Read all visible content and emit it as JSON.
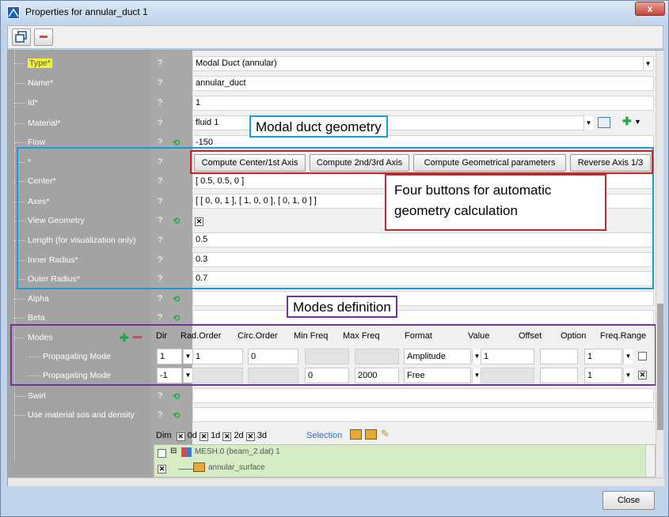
{
  "window": {
    "title": "Properties for annular_duct 1",
    "close_glyph": "x"
  },
  "rows": [
    {
      "label": "Type*",
      "q": "?",
      "value": "Modal Duct (annular)"
    },
    {
      "label": "Name*",
      "q": "?",
      "value": "annular_duct"
    },
    {
      "label": "Id*",
      "q": "?",
      "value": "1"
    },
    {
      "label": "Material*",
      "q": "?",
      "value": "fluid 1"
    },
    {
      "label": "Flow",
      "q": "?",
      "value": "-150"
    },
    {
      "label": "*",
      "q": "?",
      "value": ""
    },
    {
      "label": "Center*",
      "q": "?",
      "value": "[ 0.5, 0.5, 0 ]"
    },
    {
      "label": "Axes*",
      "q": "?",
      "value": "[ [ 0, 0, 1 ], [ 1, 0, 0 ], [ 0, 1, 0 ] ]"
    },
    {
      "label": "View Geometry",
      "q": "?",
      "value": ""
    },
    {
      "label": "Length (for visualization only)",
      "q": "?",
      "value": "0.5"
    },
    {
      "label": "Inner Radius*",
      "q": "?",
      "value": "0.3"
    },
    {
      "label": "Outer Radius*",
      "q": "?",
      "value": "0.7"
    },
    {
      "label": "Alpha",
      "q": "?",
      "value": ""
    },
    {
      "label": "Beta",
      "q": "?",
      "value": ""
    },
    {
      "label": "Modes",
      "q": "",
      "value": ""
    },
    {
      "label": "Propagating Mode",
      "q": "",
      "value": ""
    },
    {
      "label": "Propagating Mode",
      "q": "",
      "value": ""
    },
    {
      "label": "Swirl",
      "q": "?",
      "value": ""
    },
    {
      "label": "Use material sos and density",
      "q": "?",
      "value": ""
    }
  ],
  "compute_buttons": [
    "Compute Center/1st Axis",
    "Compute 2nd/3rd Axis",
    "Compute Geometrical parameters",
    "Reverse Axis 1/3"
  ],
  "modes": {
    "headers": [
      "Dir",
      "Rad.Order",
      "Circ.Order",
      "Min Freq",
      "Max Freq",
      "Format",
      "Value",
      "Offset",
      "Option",
      "Freq.Range"
    ],
    "row1": {
      "dir": "1",
      "rad": "1",
      "circ": "0",
      "format": "Amplitude",
      "value": "1",
      "option": "1"
    },
    "row2": {
      "dir": "-1",
      "min": "0",
      "max": "2000",
      "format": "Free",
      "option": "1"
    }
  },
  "dim": {
    "label": "Dim",
    "items": [
      "0d",
      "1d",
      "2d",
      "3d"
    ],
    "selection": "Selection"
  },
  "tree": {
    "mesh": "MESH.0 (beam_2.dat) 1",
    "surface": "annular_surface"
  },
  "annotations": {
    "geometry": "Modal duct geometry",
    "buttons_line1": "Four buttons for automatic",
    "buttons_line2": "geometry calculation",
    "modes": "Modes definition"
  },
  "footer": {
    "close": "Close"
  },
  "colors": {
    "blue": "#1a9bdc",
    "red": "#c0282a",
    "purple": "#7530a0",
    "type_highlight": "#f2f230"
  }
}
